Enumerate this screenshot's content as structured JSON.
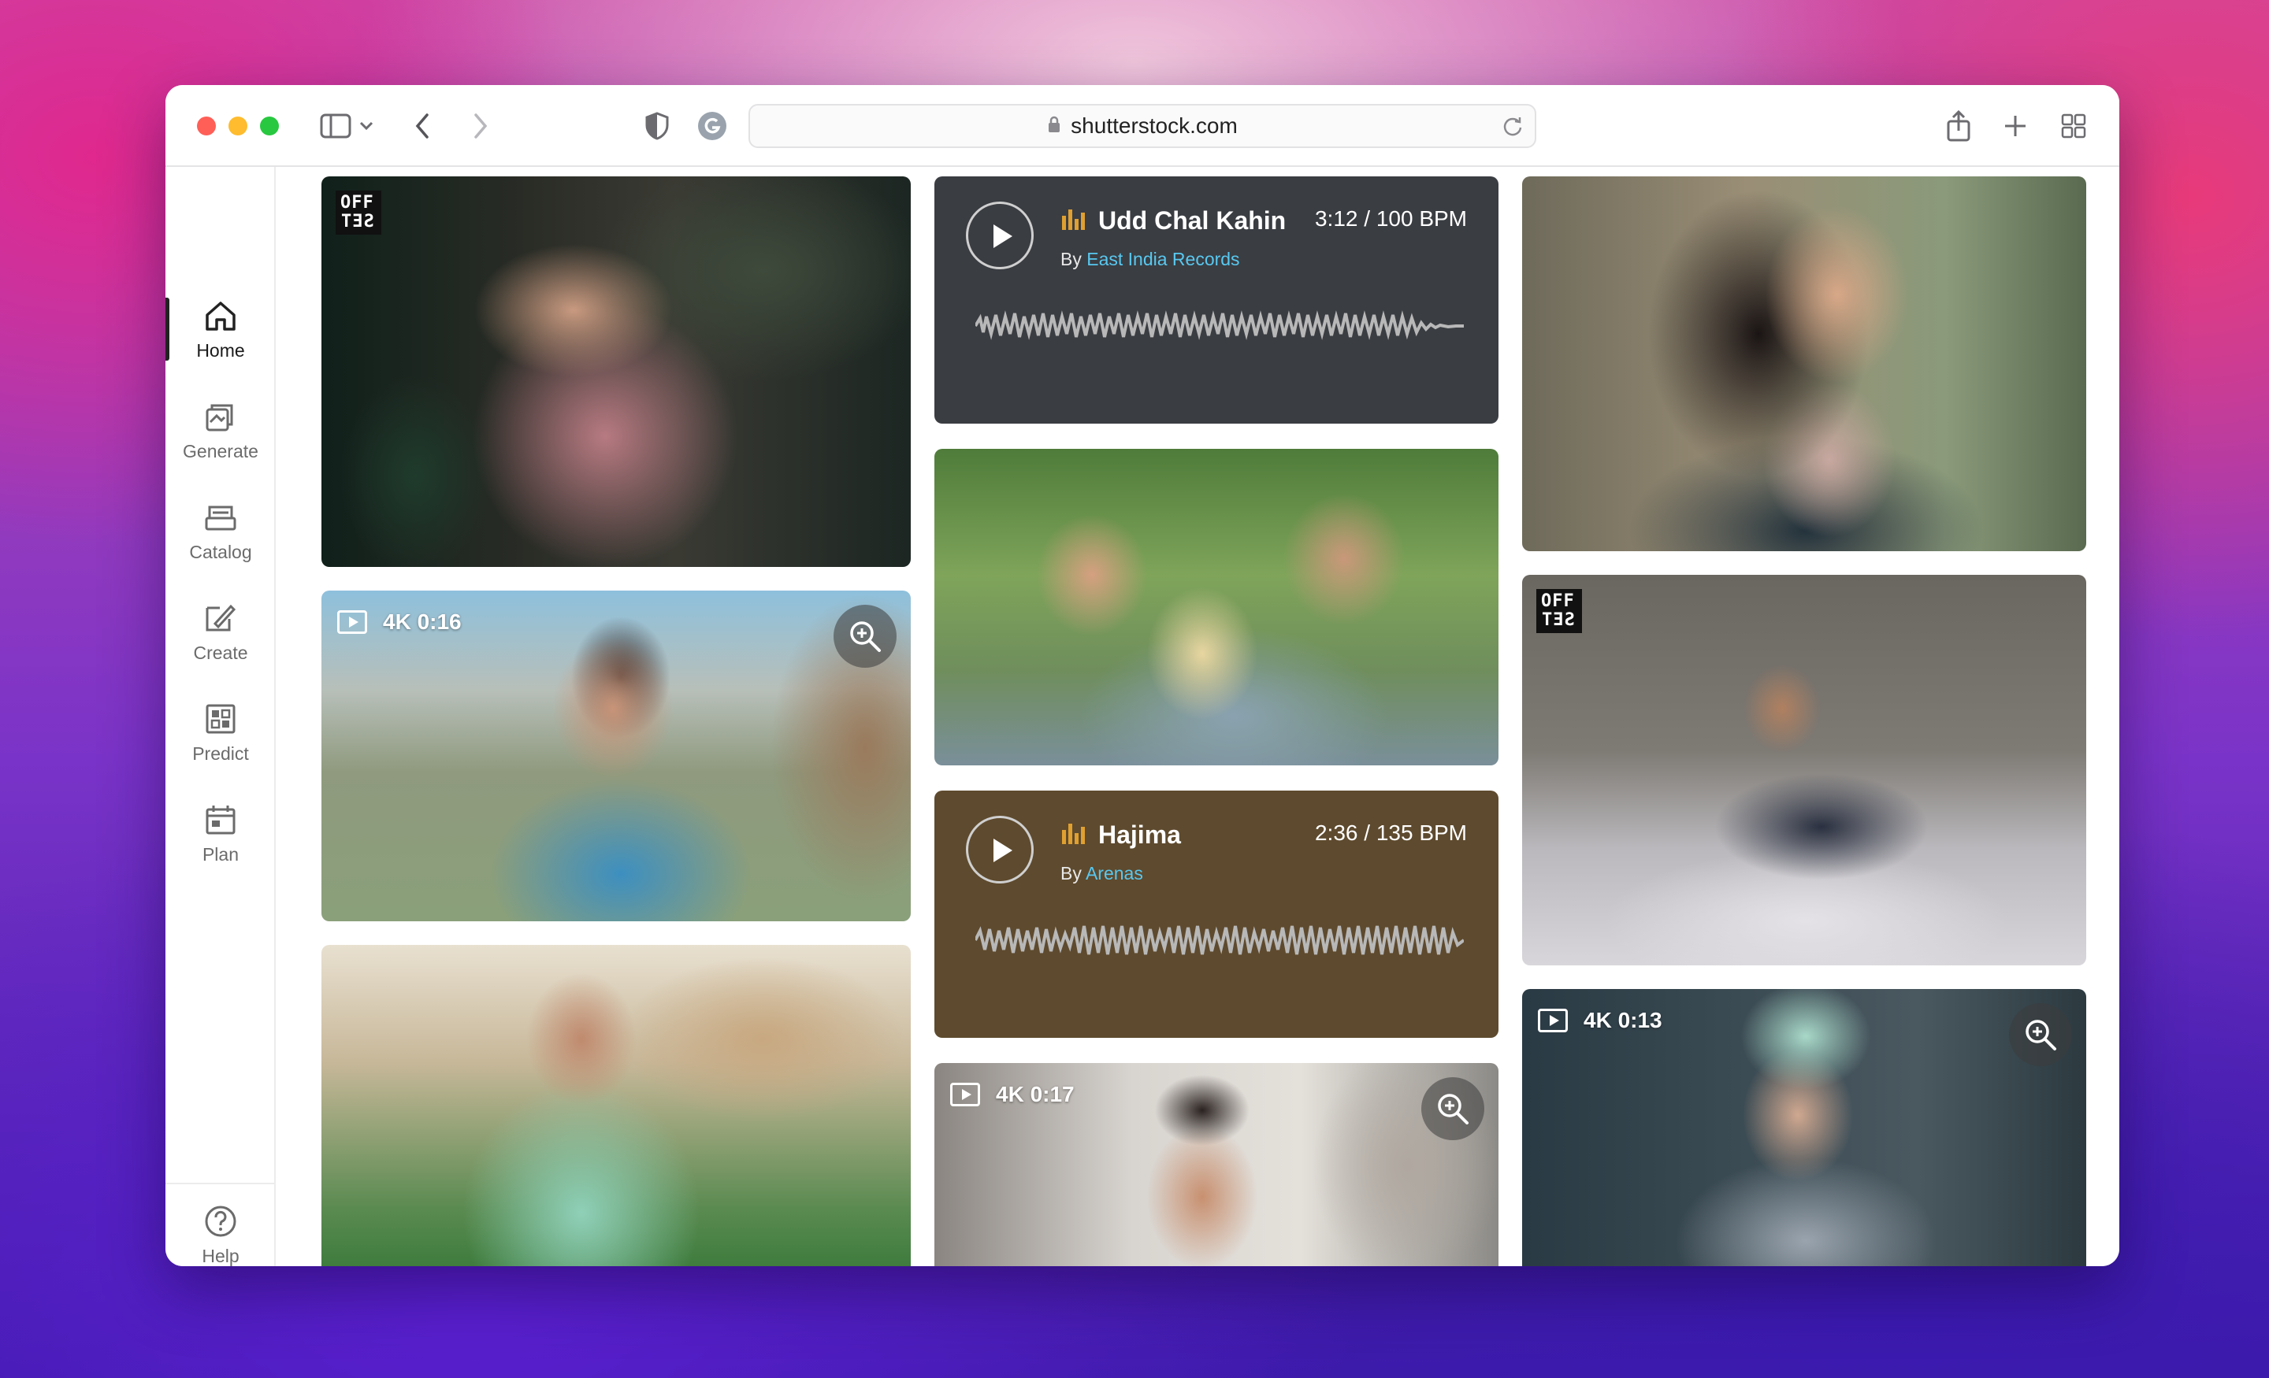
{
  "browser": {
    "url": "shutterstock.com"
  },
  "sidebar": {
    "items": [
      {
        "label": "Home",
        "icon": "home-icon",
        "active": true
      },
      {
        "label": "Generate",
        "icon": "generate-icon"
      },
      {
        "label": "Catalog",
        "icon": "catalog-icon"
      },
      {
        "label": "Create",
        "icon": "create-icon"
      },
      {
        "label": "Predict",
        "icon": "predict-icon"
      },
      {
        "label": "Plan",
        "icon": "plan-icon"
      }
    ],
    "help": "Help"
  },
  "tiles": {
    "offset_badge_top": "OFF",
    "offset_badge_bottom": "SET",
    "video1_label": "4K 0:16",
    "video2_label": "4K 0:17",
    "video3_label": "4K 0:13",
    "audio1": {
      "title": "Udd Chal Kahin",
      "meta": "3:12 / 100 BPM",
      "by": "By",
      "artist": "East India Records"
    },
    "audio2": {
      "title": "Hajima",
      "meta": "2:36 / 135 BPM",
      "by": "By",
      "artist": "Arenas"
    }
  },
  "colors": {
    "accent_link": "#58c8f0",
    "audio1_bg": "#3a3d42",
    "audio2_bg": "#5e4a2e",
    "bars_icon": "#e0a030"
  }
}
